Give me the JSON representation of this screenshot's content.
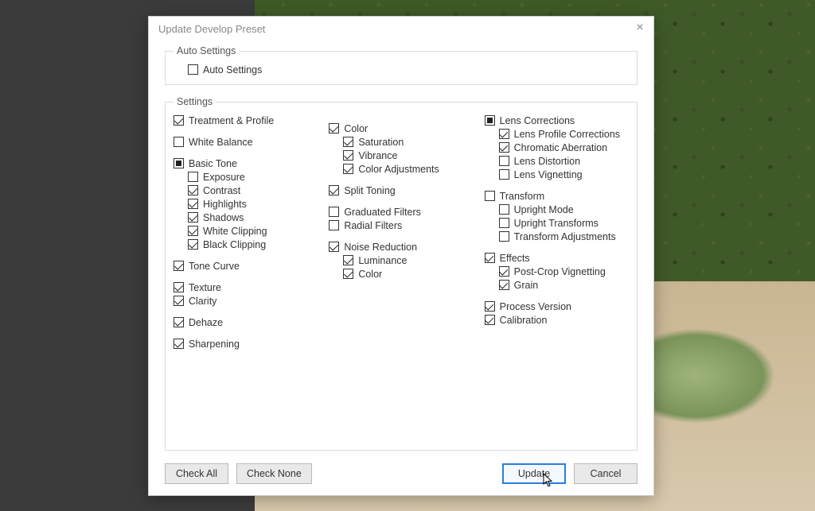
{
  "dialog": {
    "title": "Update Develop Preset",
    "auto_settings_group": "Auto Settings",
    "auto_settings_item": "Auto Settings",
    "settings_group": "Settings",
    "buttons": {
      "check_all": "Check All",
      "check_none": "Check None",
      "update": "Update",
      "cancel": "Cancel"
    }
  },
  "col1": {
    "treatment_profile": "Treatment & Profile",
    "white_balance": "White Balance",
    "basic_tone": "Basic Tone",
    "exposure": "Exposure",
    "contrast": "Contrast",
    "highlights": "Highlights",
    "shadows": "Shadows",
    "white_clipping": "White Clipping",
    "black_clipping": "Black Clipping",
    "tone_curve": "Tone Curve",
    "texture": "Texture",
    "clarity": "Clarity",
    "dehaze": "Dehaze",
    "sharpening": "Sharpening"
  },
  "col2": {
    "color": "Color",
    "saturation": "Saturation",
    "vibrance": "Vibrance",
    "color_adjustments": "Color Adjustments",
    "split_toning": "Split Toning",
    "graduated_filters": "Graduated Filters",
    "radial_filters": "Radial Filters",
    "noise_reduction": "Noise Reduction",
    "luminance": "Luminance",
    "nr_color": "Color"
  },
  "col3": {
    "lens_corrections": "Lens Corrections",
    "lens_profile_corrections": "Lens Profile Corrections",
    "chromatic_aberration": "Chromatic Aberration",
    "lens_distortion": "Lens Distortion",
    "lens_vignetting": "Lens Vignetting",
    "transform": "Transform",
    "upright_mode": "Upright Mode",
    "upright_transforms": "Upright Transforms",
    "transform_adjustments": "Transform Adjustments",
    "effects": "Effects",
    "post_crop_vignetting": "Post-Crop Vignetting",
    "grain": "Grain",
    "process_version": "Process Version",
    "calibration": "Calibration"
  }
}
